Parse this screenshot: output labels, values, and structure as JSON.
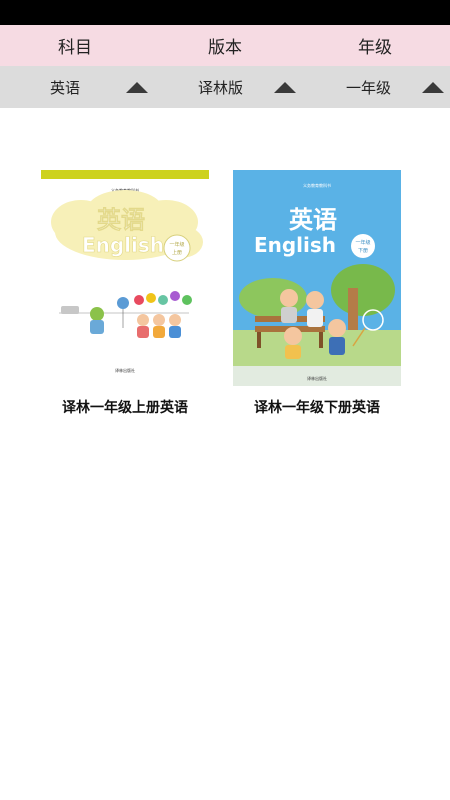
{
  "header": {
    "subject_label": "科目",
    "edition_label": "版本",
    "grade_label": "年级"
  },
  "filters": {
    "subject": "英语",
    "edition": "译林版",
    "grade": "一年级"
  },
  "books": [
    {
      "title": "译林一年级上册英语",
      "cover": {
        "series": "义务教育教科书",
        "subject": "英语",
        "english": "English",
        "grade": "一年级",
        "volume": "上册",
        "publisher": "译林出版社"
      }
    },
    {
      "title": "译林一年级下册英语",
      "cover": {
        "series": "义务教育教科书",
        "subject": "英语",
        "english": "English",
        "grade": "一年级",
        "volume": "下册",
        "publisher": "译林出版社"
      }
    }
  ],
  "colors": {
    "header_bg": "#f6dbe3",
    "filter_bg": "#dcdcdc",
    "cover1_stripe": "#cdd21d",
    "cover2_bg": "#5ab2e6"
  }
}
